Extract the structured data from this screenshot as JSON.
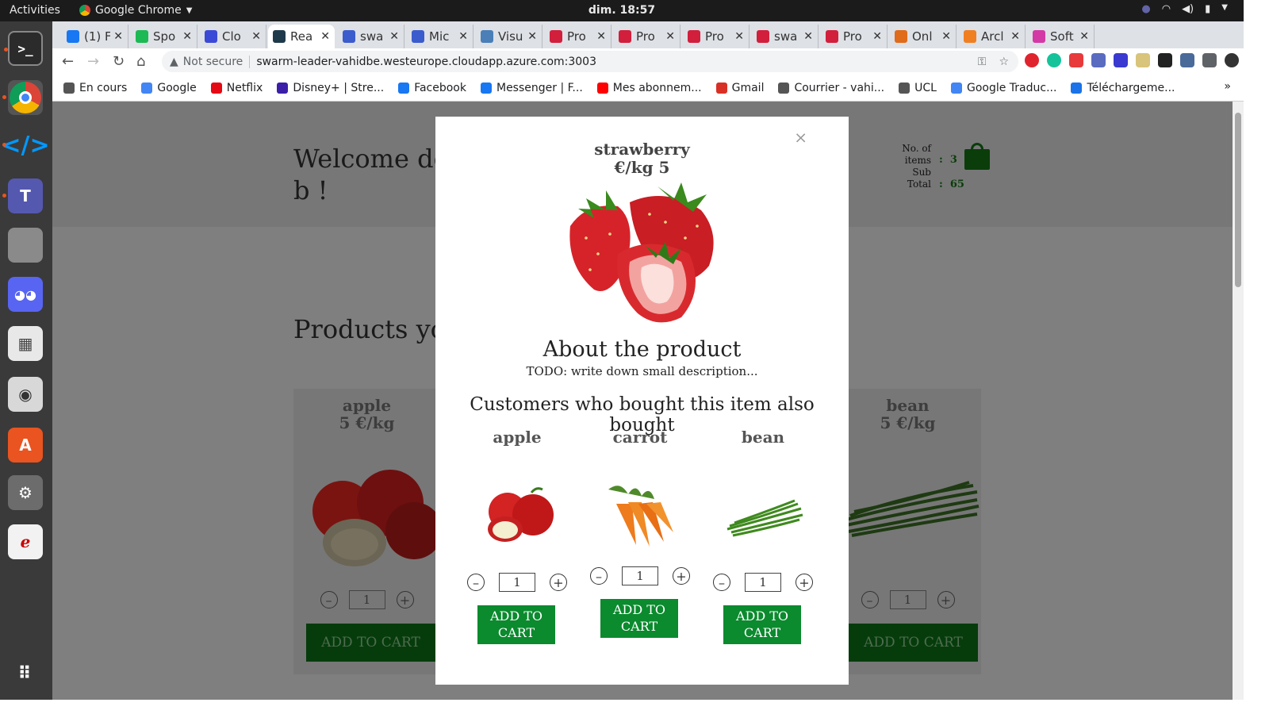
{
  "system": {
    "activities": "Activities",
    "app_name": "Google Chrome",
    "clock": "dim. 18:57"
  },
  "dock": {
    "items": [
      "terminal",
      "chrome",
      "vscode",
      "teams",
      "files",
      "discord",
      "calculator",
      "camera",
      "software-store",
      "settings",
      "pdf-viewer",
      "app-grid"
    ]
  },
  "tabs": [
    {
      "label": "(1) F",
      "color": "#1877f2"
    },
    {
      "label": "Spo",
      "color": "#1db954"
    },
    {
      "label": "Clo",
      "color": "#3a4ad6"
    },
    {
      "label": "Rea",
      "color": "#1e3a4a"
    },
    {
      "label": "swa",
      "color": "#3b5ccc"
    },
    {
      "label": "Mic",
      "color": "#3b5ccc"
    },
    {
      "label": "Visu",
      "color": "#4a7fb8"
    },
    {
      "label": "Pro",
      "color": "#d21f3c"
    },
    {
      "label": "Pro",
      "color": "#d21f3c"
    },
    {
      "label": "Pro",
      "color": "#d21f3c"
    },
    {
      "label": "swa",
      "color": "#d21f3c"
    },
    {
      "label": "Pro",
      "color": "#d21f3c"
    },
    {
      "label": "Onl",
      "color": "#e06b1a"
    },
    {
      "label": "Arcl",
      "color": "#f07f22"
    },
    {
      "label": "Soft",
      "color": "#d33aa6"
    }
  ],
  "browser": {
    "not_secure": "Not secure",
    "url": "swarm-leader-vahidbe.westeurope.cloudapp.azure.com:3003"
  },
  "bookmarks": [
    {
      "label": "En cours",
      "color": "#555555"
    },
    {
      "label": "Google",
      "color": "#4285f4"
    },
    {
      "label": "Netflix",
      "color": "#e50914"
    },
    {
      "label": "Disney+ | Stre...",
      "color": "#3b1fa8"
    },
    {
      "label": "Facebook",
      "color": "#1877f2"
    },
    {
      "label": "Messenger | F...",
      "color": "#1877f2"
    },
    {
      "label": "Mes abonnem...",
      "color": "#ff0000"
    },
    {
      "label": "Gmail",
      "color": "#d93025"
    },
    {
      "label": "Courrier - vahi...",
      "color": "#555555"
    },
    {
      "label": "UCL",
      "color": "#555555"
    },
    {
      "label": "Google Traduc...",
      "color": "#4285f4"
    },
    {
      "label": "Téléchargeme...",
      "color": "#1a73e8"
    }
  ],
  "page": {
    "welcome_line1": "Welcome dea",
    "welcome_line2": "b !",
    "cart": {
      "items_label": "No. of items",
      "items_value": "3",
      "subtotal_label": "Sub Total",
      "subtotal_value": "65"
    },
    "products_title": "Products you",
    "bg_products": [
      {
        "name": "apple",
        "price": "5 €/kg",
        "qty": "1",
        "button": "ADD TO CART"
      },
      {
        "name": "bean",
        "price": "5 €/kg",
        "qty": "1",
        "button": "ADD TO CART"
      }
    ]
  },
  "modal": {
    "close": "×",
    "product_name": "strawberry",
    "product_price": "€/kg 5",
    "about_title": "About the product",
    "description": "TODO: write down small description...",
    "also_bought_title": "Customers who bought this item also bought",
    "recommendations": [
      {
        "name": "apple",
        "qty": "1",
        "button": "ADD TO CART"
      },
      {
        "name": "carrot",
        "qty": "1",
        "button": "ADD TO CART"
      },
      {
        "name": "bean",
        "qty": "1",
        "button": "ADD TO CART"
      }
    ]
  },
  "colors": {
    "accent_green": "#0b8a2e",
    "dark_green": "#063c0c",
    "overlay": "#7f7f7f"
  }
}
